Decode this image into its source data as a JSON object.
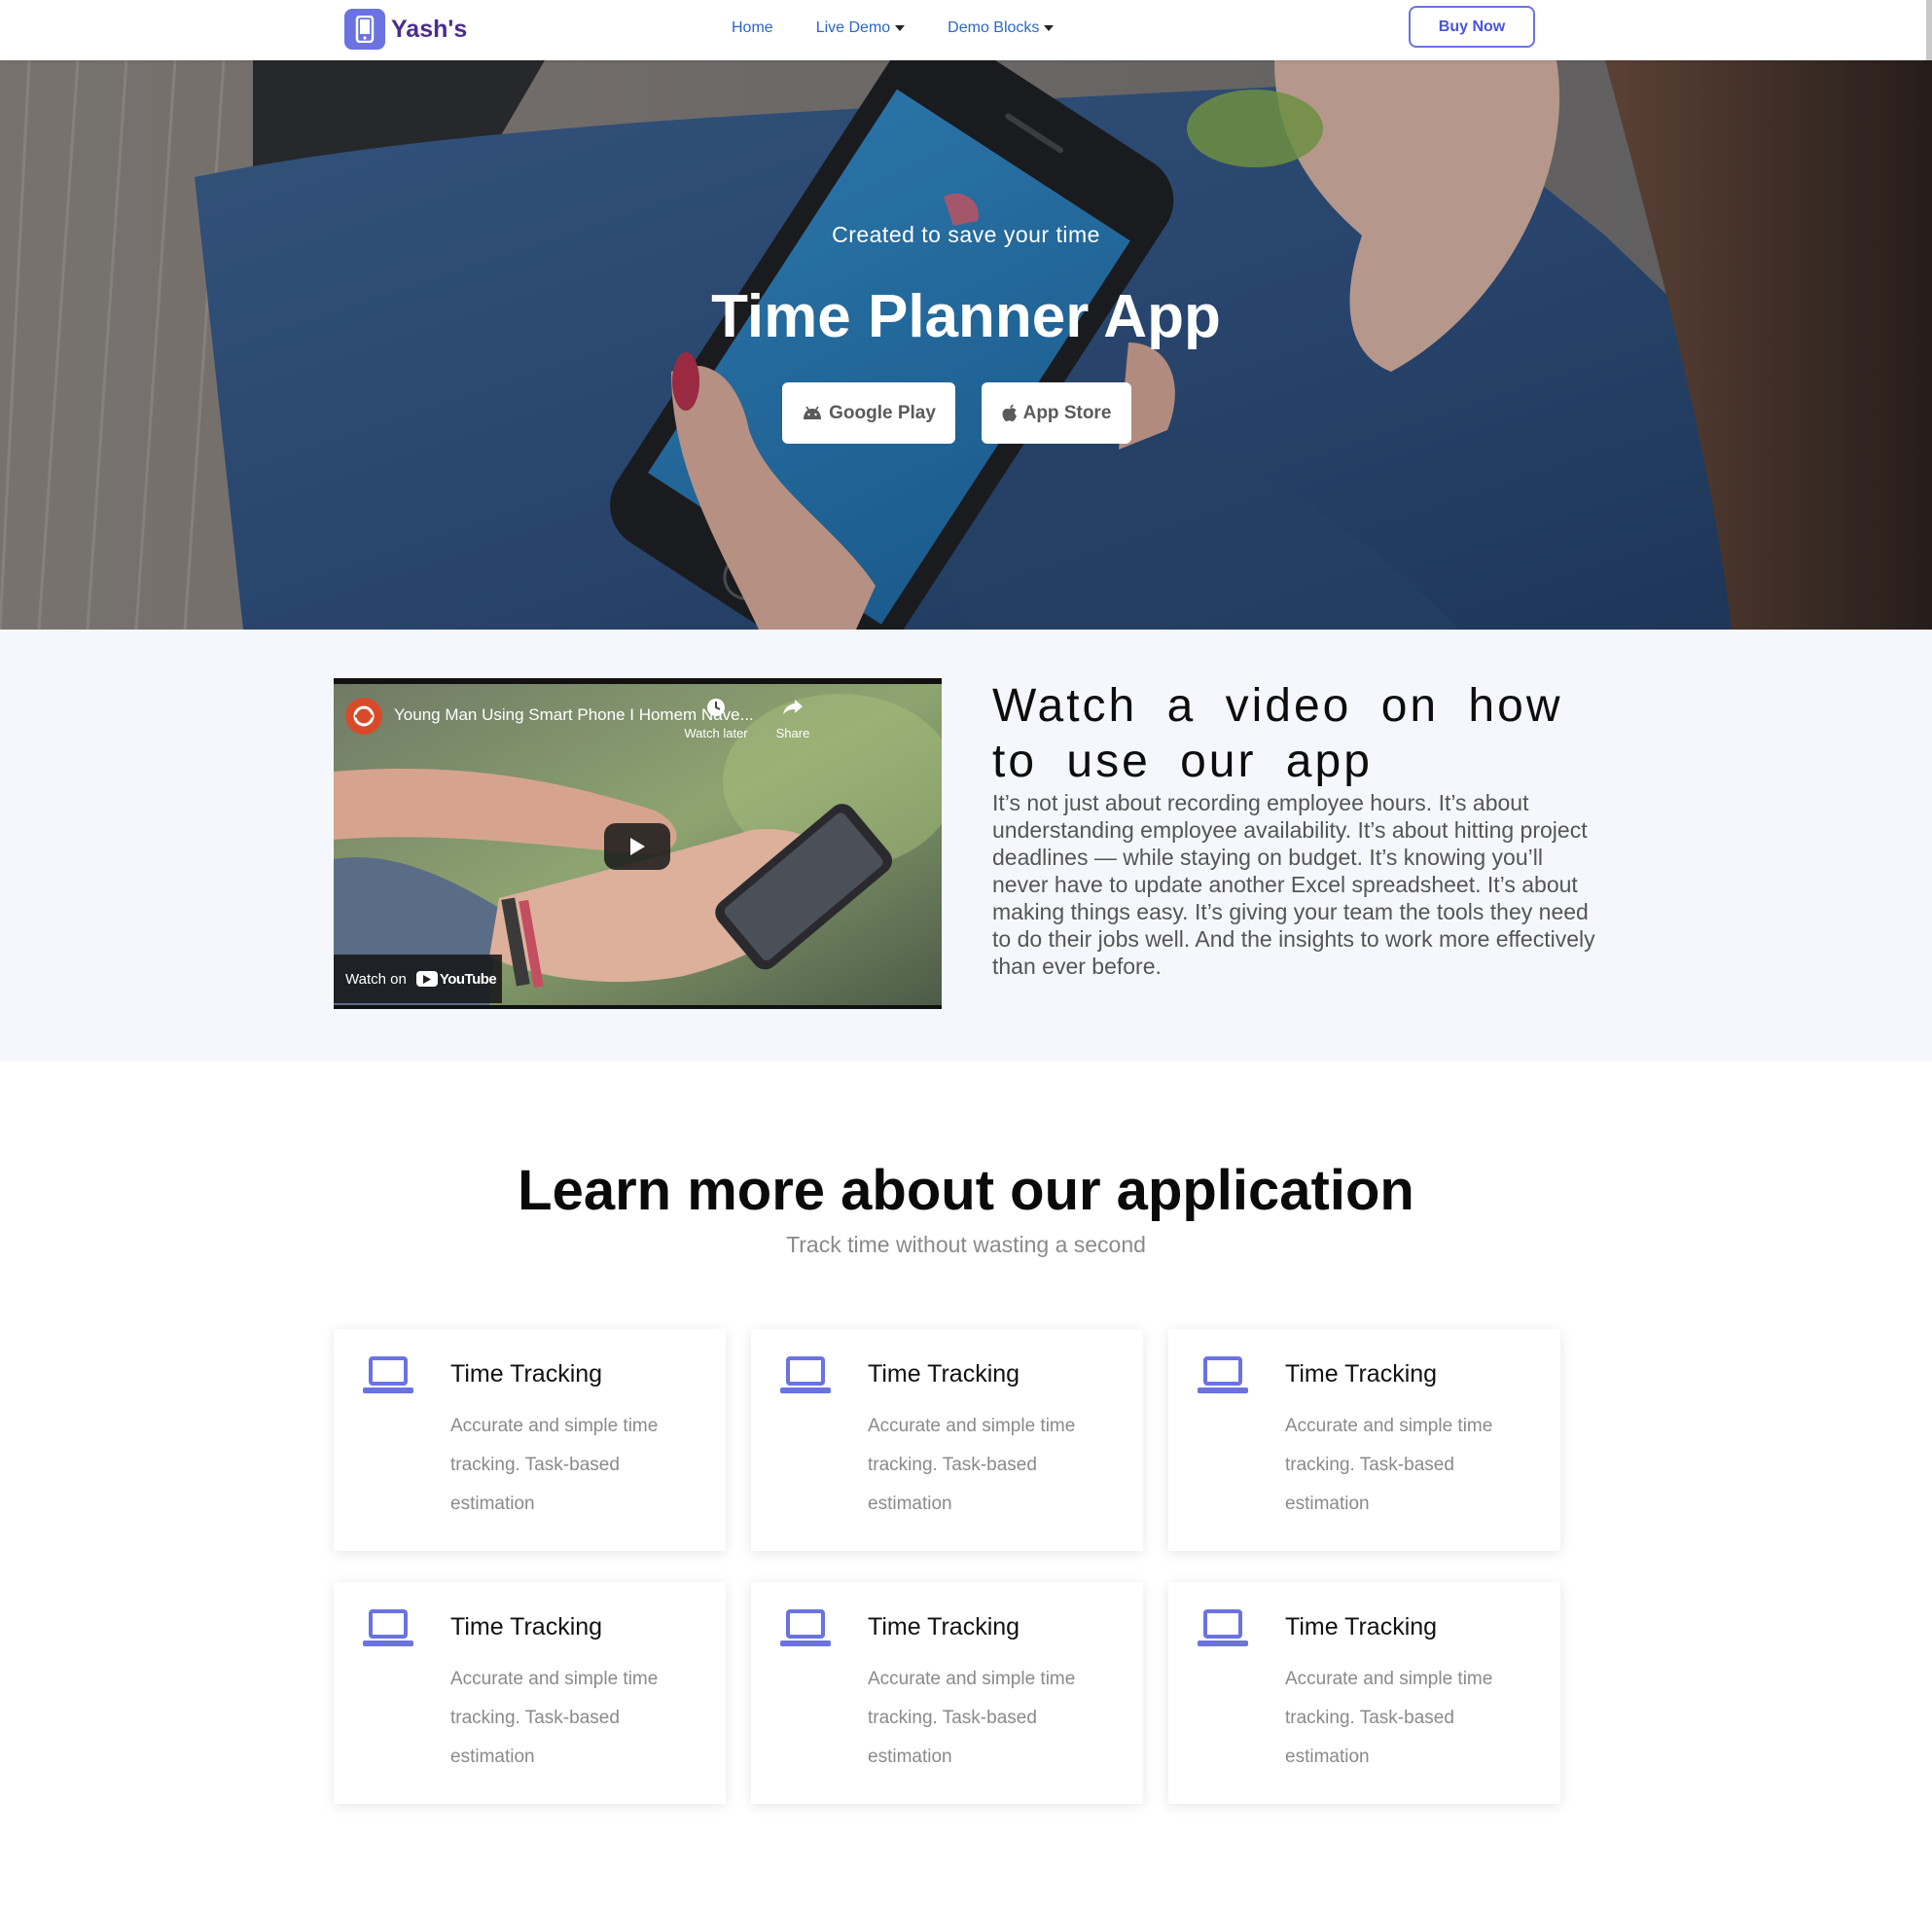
{
  "nav": {
    "brand": "Yash's",
    "links": [
      {
        "label": "Home",
        "has_dropdown": false
      },
      {
        "label": "Live Demo",
        "has_dropdown": true
      },
      {
        "label": "Demo Blocks",
        "has_dropdown": true
      }
    ],
    "buy_label": "Buy Now"
  },
  "hero": {
    "subtitle": "Created to save your time",
    "title": "Time Planner App",
    "google_play_label": "Google Play",
    "app_store_label": "App Store"
  },
  "video_section": {
    "video_title": "Young Man Using Smart Phone I Homem Nave...",
    "watch_later_label": "Watch later",
    "share_label": "Share",
    "watch_on_label": "Watch on",
    "youtube_label": "YouTube",
    "heading": "Watch a video on how to use our app",
    "paragraph": "It’s not just about recording employee hours. It’s about understanding employee availability. It’s about hitting project deadlines — while staying on budget. It’s knowing you’ll never have to update another Excel spreadsheet. It’s about making things easy. It’s giving your team the tools they need to do their jobs well. And the insights to work more effectively than ever before."
  },
  "features": {
    "title": "Learn more about our application",
    "subtitle": "Track time without wasting a second",
    "cards": [
      {
        "title": "Time Tracking",
        "description": "Accurate and simple time tracking. Task-based estimation",
        "icon": "laptop-icon"
      },
      {
        "title": "Time Tracking",
        "description": "Accurate and simple time tracking. Task-based estimation",
        "icon": "laptop-icon"
      },
      {
        "title": "Time Tracking",
        "description": "Accurate and simple time tracking. Task-based estimation",
        "icon": "laptop-icon"
      },
      {
        "title": "Time Tracking",
        "description": "Accurate and simple time tracking. Task-based estimation",
        "icon": "laptop-icon"
      },
      {
        "title": "Time Tracking",
        "description": "Accurate and simple time tracking. Task-based estimation",
        "icon": "laptop-icon"
      },
      {
        "title": "Time Tracking",
        "description": "Accurate and simple time tracking. Task-based estimation",
        "icon": "laptop-icon"
      }
    ]
  },
  "colors": {
    "accent": "#6a73e0",
    "brand_text": "#4b2c8f",
    "nav_link": "#2a67c8",
    "section_bg": "#f6f7fc"
  }
}
